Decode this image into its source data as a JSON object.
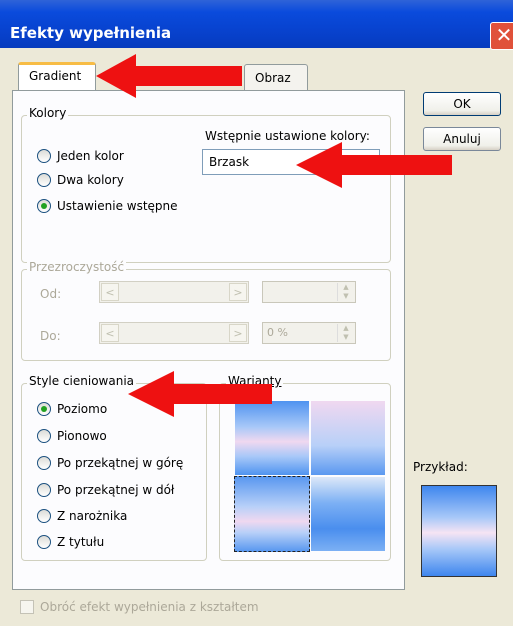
{
  "window": {
    "title": "Efekty wypełnienia",
    "close_glyph": "✕"
  },
  "tabs": [
    {
      "label": "Gradient"
    },
    {
      "label": "Obraz"
    }
  ],
  "buttons": {
    "ok": "OK",
    "cancel": "Anuluj"
  },
  "colors_group": {
    "title": "Kolory",
    "preset_label": "Wstępnie ustawione kolory:",
    "preset_value": "Brzask",
    "options": [
      {
        "label": "Jeden kolor",
        "selected": false
      },
      {
        "label": "Dwa kolory",
        "selected": false
      },
      {
        "label": "Ustawienie wstępne",
        "selected": true
      }
    ]
  },
  "transparency_group": {
    "title": "Przezroczystość",
    "from_label": "Od:",
    "from_value": "",
    "to_label": "Do:",
    "to_value": "0 %"
  },
  "shading_group": {
    "title": "Style cieniowania",
    "options": [
      {
        "label": "Poziomo",
        "selected": true
      },
      {
        "label": "Pionowo",
        "selected": false
      },
      {
        "label": "Po przekątnej w górę",
        "selected": false
      },
      {
        "label": "Po przekątnej w dół",
        "selected": false
      },
      {
        "label": "Z narożnika",
        "selected": false
      },
      {
        "label": "Z tytułu",
        "selected": false
      }
    ]
  },
  "variants_group": {
    "title": "Warianty"
  },
  "preview": {
    "label": "Przykład:"
  },
  "rotate_checkbox": {
    "label": "Obróć efekt wypełnienia z kształtem",
    "checked": false
  },
  "colors": {
    "arrow": "#EE1111",
    "title_bar": "#0A4BDC",
    "background": "#ECE9D8"
  }
}
